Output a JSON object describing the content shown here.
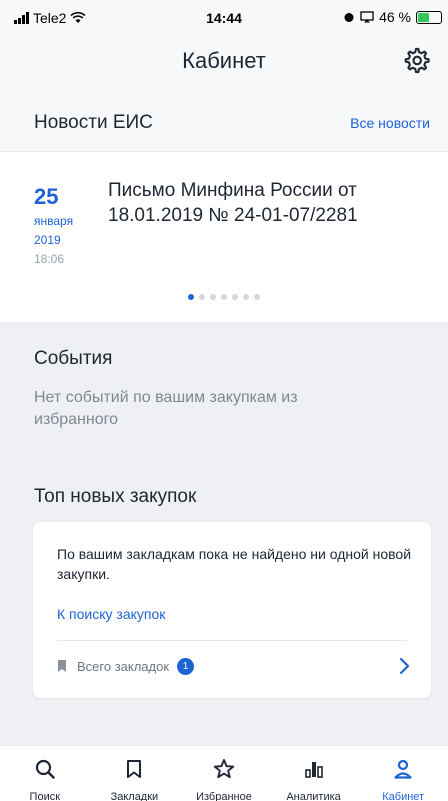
{
  "status_bar": {
    "carrier": "Tele2",
    "time": "14:44",
    "battery": "46 %"
  },
  "header": {
    "title": "Кабинет",
    "settings_icon": "gear-icon"
  },
  "news": {
    "section_title": "Новости ЕИС",
    "all_link": "Все новости",
    "item": {
      "day": "25",
      "month": "января",
      "year": "2019",
      "time": "18:06",
      "text": "Письмо Минфина России от 18.01.2019 № 24-01-07/2281"
    },
    "pagination": {
      "current": 1,
      "total": 7
    }
  },
  "events": {
    "title": "События",
    "empty_text": "Нет событий по вашим закупкам из избранного"
  },
  "top_purchases": {
    "title": "Топ новых закупок",
    "card": {
      "message": "По вашим закладкам пока не найдено ни одной новой закупки.",
      "search_link": "К поиску закупок",
      "bookmarks_label": "Всего закладок",
      "bookmarks_count": "1"
    }
  },
  "tabbar": {
    "tabs": [
      {
        "label": "Поиск",
        "icon": "search-icon",
        "active": false
      },
      {
        "label": "Закладки",
        "icon": "bookmark-icon",
        "active": false
      },
      {
        "label": "Избранное",
        "icon": "star-icon",
        "active": false
      },
      {
        "label": "Аналитика",
        "icon": "bar-chart-icon",
        "active": false
      },
      {
        "label": "Кабинет",
        "icon": "person-icon",
        "active": true
      }
    ]
  },
  "colors": {
    "accent": "#1e63d6",
    "background_grey": "#eef0f3",
    "text": "#1f2633"
  }
}
